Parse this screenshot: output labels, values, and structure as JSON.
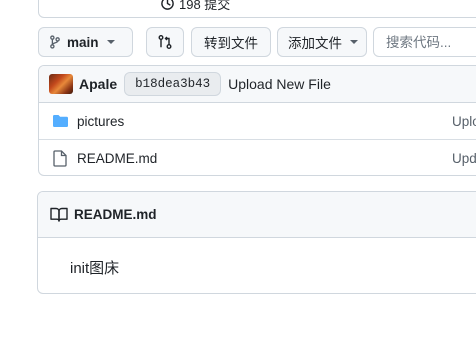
{
  "repo": {
    "commit_count_label": "198 提交"
  },
  "toolbar": {
    "branch": "main",
    "goto_file": "转到文件",
    "add_file": "添加文件",
    "search_placeholder": "搜索代码..."
  },
  "latest_commit": {
    "author": "Apale",
    "sha": "b18dea3b43",
    "message": "Upload New File"
  },
  "files": [
    {
      "name": "pictures",
      "type": "folder",
      "last_commit": "Uplo"
    },
    {
      "name": "README.md",
      "type": "file",
      "last_commit": "Upd"
    }
  ],
  "readme": {
    "title": "README.md",
    "content": "init图床"
  },
  "colors": {
    "border": "#d0d7de",
    "folder": "#54aeff",
    "muted": "#57606a",
    "header_bg": "#f6f8fa"
  }
}
